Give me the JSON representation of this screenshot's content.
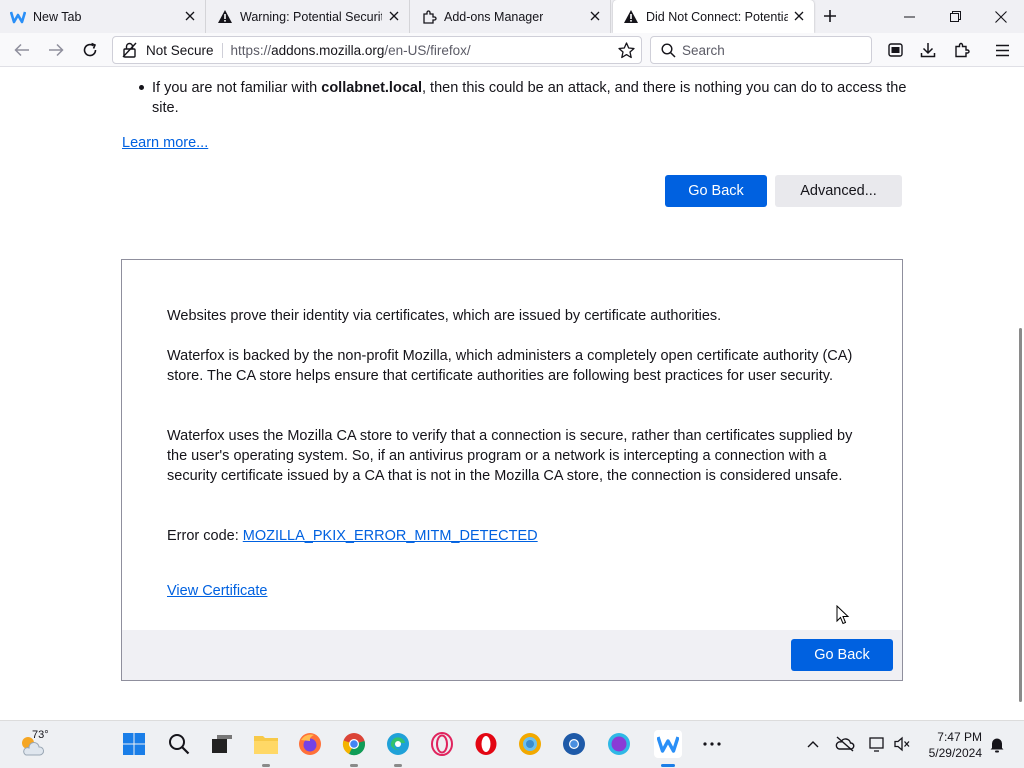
{
  "colors": {
    "accent": "#0061e0",
    "tabstrip_bg": "#f0f0f4",
    "footer_bg": "#f0f0f4"
  },
  "tabs": [
    {
      "title": "New Tab",
      "icon": "waterfox-icon"
    },
    {
      "title": "Warning: Potential Security",
      "icon": "warning-icon"
    },
    {
      "title": "Add-ons Manager",
      "icon": "puzzle-icon"
    },
    {
      "title": "Did Not Connect: Potential",
      "icon": "warning-icon",
      "active": true
    }
  ],
  "navbar": {
    "not_secure": "Not Secure",
    "url_prefix": "https://",
    "url_domain": "addons.mozilla.org",
    "url_path": "/en-US/firefox/",
    "search_placeholder": "Search"
  },
  "page": {
    "bullet_prefix": "If you are not familiar with ",
    "bullet_host": "collabnet.local",
    "bullet_suffix": ", then this could be an attack, and there is nothing you can do to access the site.",
    "learn_more": "Learn more...",
    "go_back": "Go Back",
    "advanced": "Advanced..."
  },
  "advanced_panel": {
    "p1": "Websites prove their identity via certificates, which are issued by certificate authorities.",
    "p2": "Waterfox is backed by the non-profit Mozilla, which administers a completely open certificate authority (CA) store. The CA store helps ensure that certificate authorities are following best practices for user security.",
    "p3": "Waterfox uses the Mozilla CA store to verify that a connection is secure, rather than certificates supplied by the user's operating system. So, if an antivirus program or a network is intercepting a connection with a security certificate issued by a CA that is not in the Mozilla CA store, the connection is considered unsafe.",
    "error_label": "Error code: ",
    "error_code": "MOZILLA_PKIX_ERROR_MITM_DETECTED",
    "view_certificate": "View Certificate",
    "go_back": "Go Back"
  },
  "taskbar": {
    "temperature": "73°",
    "time": "7:47 PM",
    "date": "5/29/2024"
  }
}
